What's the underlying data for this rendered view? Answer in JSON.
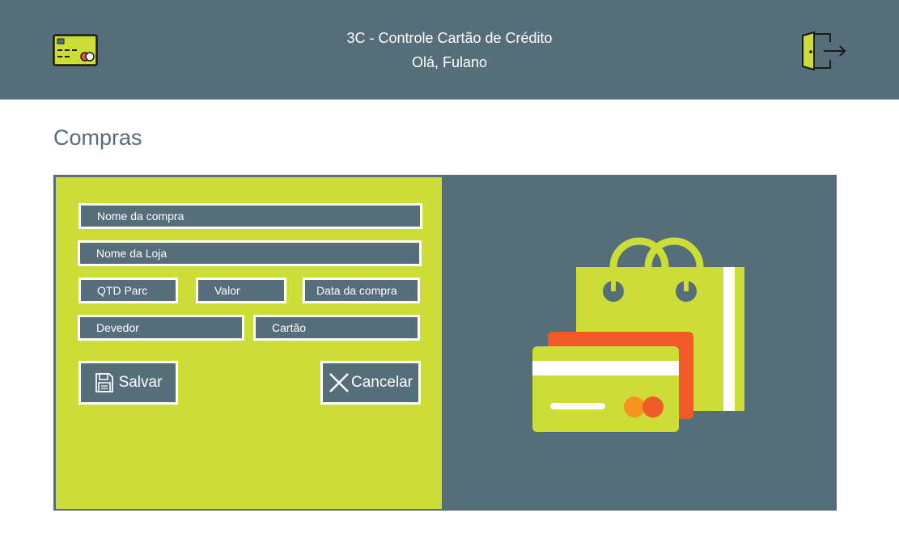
{
  "header": {
    "title": "3C - Controle Cartão de Crédito",
    "greeting": "Olá, Fulano",
    "logo_icon": "credit-card-icon",
    "logout_icon": "logout-door-icon"
  },
  "page": {
    "title": "Compras"
  },
  "form": {
    "nome_compra": {
      "placeholder": "Nome da compra",
      "value": ""
    },
    "nome_loja": {
      "placeholder": "Nome da Loja",
      "value": ""
    },
    "qtd_parc": {
      "placeholder": "QTD Parc",
      "value": ""
    },
    "valor": {
      "placeholder": "Valor",
      "value": ""
    },
    "data_compra": {
      "placeholder": "Data da compra",
      "value": ""
    },
    "devedor": {
      "placeholder": "Devedor",
      "value": ""
    },
    "cartao": {
      "placeholder": "Cartão",
      "value": ""
    }
  },
  "actions": {
    "save_label": "Salvar",
    "save_icon": "floppy-disk-icon",
    "cancel_label": "Cancelar",
    "cancel_icon": "close-icon"
  },
  "colors": {
    "primary": "#566e7a",
    "accent": "#cddd37",
    "card_back": "#f05a28",
    "card_dot_left": "#f7941d",
    "card_dot_right": "#ef5a29"
  },
  "illustration": {
    "icon": "shopping-bag-with-credit-cards-icon"
  }
}
